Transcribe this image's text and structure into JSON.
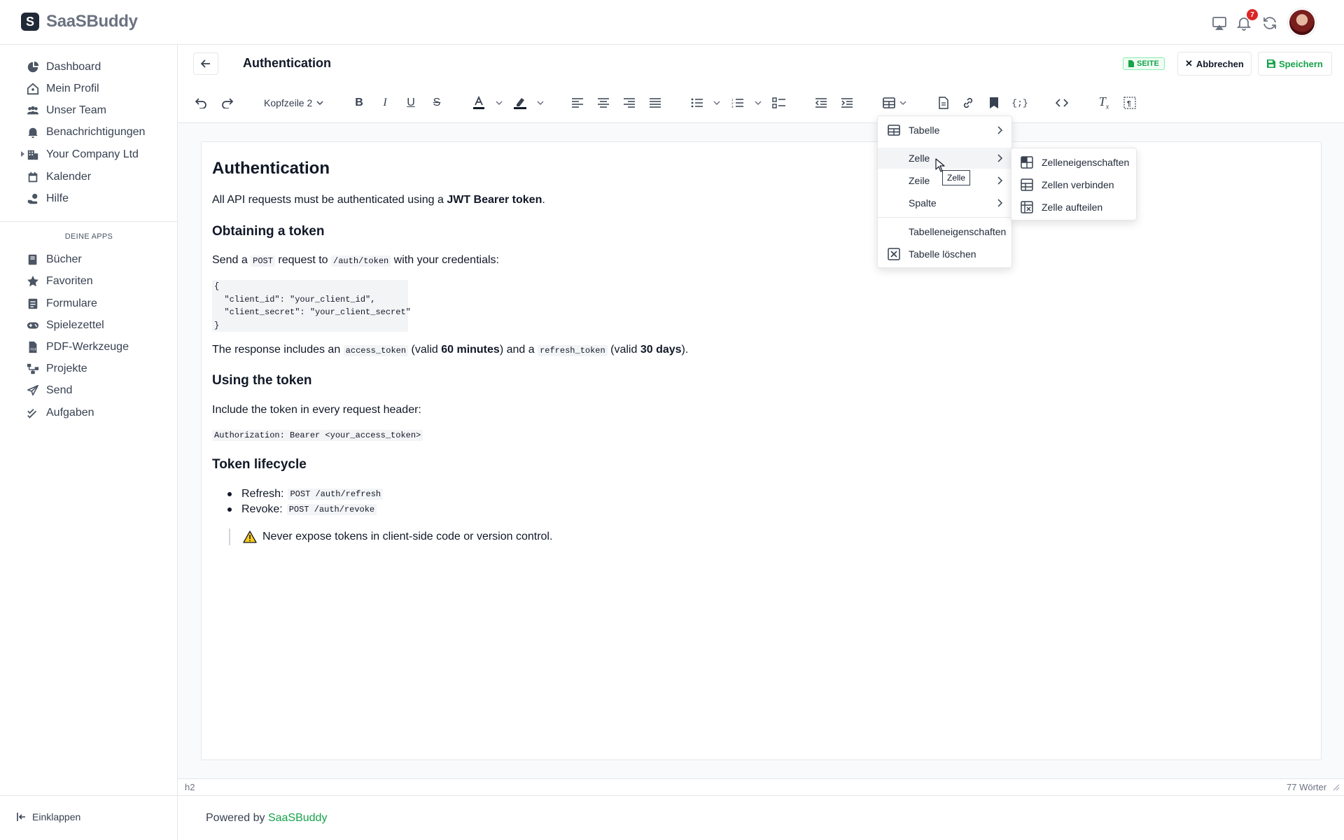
{
  "brand": {
    "name": "SaaSBuddy"
  },
  "topbar": {
    "notification_count": "7"
  },
  "sidebar": {
    "items": [
      {
        "label": "Dashboard",
        "icon": "pie-chart-icon"
      },
      {
        "label": "Mein Profil",
        "icon": "home-user-icon"
      },
      {
        "label": "Unser Team",
        "icon": "users-icon"
      },
      {
        "label": "Benachrichtigungen",
        "icon": "bell-icon"
      },
      {
        "label": "Your Company Ltd",
        "icon": "building-icon"
      },
      {
        "label": "Kalender",
        "icon": "calendar-icon"
      },
      {
        "label": "Hilfe",
        "icon": "help-hand-icon"
      }
    ],
    "section_label": "DEINE APPS",
    "apps": [
      {
        "label": "Bücher",
        "icon": "book-icon"
      },
      {
        "label": "Favoriten",
        "icon": "star-icon"
      },
      {
        "label": "Formulare",
        "icon": "form-icon"
      },
      {
        "label": "Spielezettel",
        "icon": "gamepad-icon"
      },
      {
        "label": "PDF-Werkzeuge",
        "icon": "pdf-icon"
      },
      {
        "label": "Projekte",
        "icon": "project-icon"
      },
      {
        "label": "Send",
        "icon": "send-icon"
      },
      {
        "label": "Aufgaben",
        "icon": "tasks-icon"
      }
    ],
    "collapse_label": "Einklappen"
  },
  "header": {
    "title": "Authentication",
    "badge": "SEITE",
    "cancel_label": "Abbrechen",
    "save_label": "Speichern"
  },
  "toolbar": {
    "block_format": "Kopfzeile 2"
  },
  "document": {
    "title": "Authentication",
    "intro_prefix": "All API requests must be authenticated using a ",
    "intro_bold": "JWT Bearer token",
    "intro_suffix": ".",
    "h_obtaining": "Obtaining a token",
    "send_a": "Send a ",
    "send_method": "POST",
    "send_mid": " request to ",
    "send_path": "/auth/token",
    "send_suffix": " with your credentials:",
    "code_lines": [
      "{",
      "  \"client_id\": \"your_client_id\",",
      "  \"client_secret\": \"your_client_secret\"",
      "}"
    ],
    "resp_a": "The response includes an ",
    "resp_access": "access_token",
    "resp_b": " (valid ",
    "resp_60": "60 minutes",
    "resp_c": ") and a ",
    "resp_refresh": "refresh_token",
    "resp_d": " (valid ",
    "resp_30": "30 days",
    "resp_e": ").",
    "h_using": "Using the token",
    "include_text": "Include the token in every request header:",
    "auth_header": "Authorization: Bearer <your_access_token>",
    "h_lifecycle": "Token lifecycle",
    "bullet_refresh_label": "Refresh: ",
    "bullet_refresh_code": "POST /auth/refresh",
    "bullet_revoke_label": "Revoke: ",
    "bullet_revoke_code": "POST /auth/revoke",
    "warning": "Never expose tokens in client-side code or version control."
  },
  "status": {
    "element_path": "h2",
    "word_count": "77 Wörter"
  },
  "footer": {
    "prefix": "Powered by ",
    "link": "SaaSBuddy"
  },
  "table_menu": {
    "items": [
      {
        "label": "Tabelle",
        "icon": "table-icon",
        "submenu": true
      },
      {
        "label": "Zelle",
        "icon": "",
        "submenu": true,
        "highlighted": true
      },
      {
        "label": "Zeile",
        "icon": "",
        "submenu": true
      },
      {
        "label": "Spalte",
        "icon": "",
        "submenu": true
      },
      {
        "label": "Tabelleneigenschaften",
        "icon": ""
      },
      {
        "label": "Tabelle löschen",
        "icon": "table-delete-icon"
      }
    ]
  },
  "cell_submenu": {
    "items": [
      {
        "label": "Zelleneigenschaften",
        "icon": "cell-properties-icon"
      },
      {
        "label": "Zellen verbinden",
        "icon": "merge-cells-icon"
      },
      {
        "label": "Zelle aufteilen",
        "icon": "split-cell-icon"
      }
    ]
  },
  "tooltip": "Zelle",
  "colors": {
    "accent_green": "#16a34a",
    "badge_red": "#dc2626",
    "text_dark": "#111827"
  }
}
